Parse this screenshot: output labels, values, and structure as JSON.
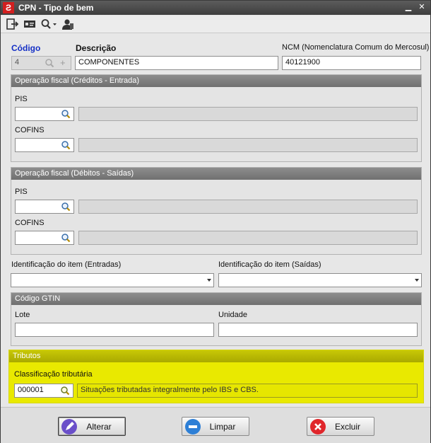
{
  "window": {
    "title": "CPN - Tipo de bem",
    "app_icon_glyph": "Ƨ"
  },
  "toolbar": {
    "icons": [
      "exit-icon",
      "id-card-icon",
      "search-dropdown-icon",
      "user-icon"
    ]
  },
  "header": {
    "codigo_label": "Código",
    "codigo_value": "4",
    "descricao_label": "Descrição",
    "descricao_value": "COMPONENTES",
    "ncm_label": "NCM (Nomenclatura Comum do Mercosul)",
    "ncm_value": "40121900"
  },
  "entrada": {
    "title": "Operação fiscal (Créditos - Entrada)",
    "pis_label": "PIS",
    "pis_value": "",
    "pis_desc": "",
    "cofins_label": "COFINS",
    "cofins_value": "",
    "cofins_desc": ""
  },
  "saida": {
    "title": "Operação fiscal (Débitos - Saídas)",
    "pis_label": "PIS",
    "pis_value": "",
    "pis_desc": "",
    "cofins_label": "COFINS",
    "cofins_value": "",
    "cofins_desc": ""
  },
  "identificacao": {
    "entradas_label": "Identificação do item (Entradas)",
    "entradas_value": "",
    "saidas_label": "Identificação do item (Saídas)",
    "saidas_value": ""
  },
  "gtin": {
    "title": "Código GTIN",
    "lote_label": "Lote",
    "lote_value": "",
    "unidade_label": "Unidade",
    "unidade_value": ""
  },
  "tributos": {
    "title": "Tributos",
    "classificacao_label": "Classificação tributária",
    "classificacao_value": "000001",
    "classificacao_desc": "Situações tributadas integralmente pelo IBS e CBS."
  },
  "buttons": {
    "alterar": "Alterar",
    "limpar": "Limpar",
    "excluir": "Excluir"
  },
  "colors": {
    "highlight": "#e9e900",
    "titlebar": "#4a4a4a",
    "app_icon": "#d21f1f"
  }
}
